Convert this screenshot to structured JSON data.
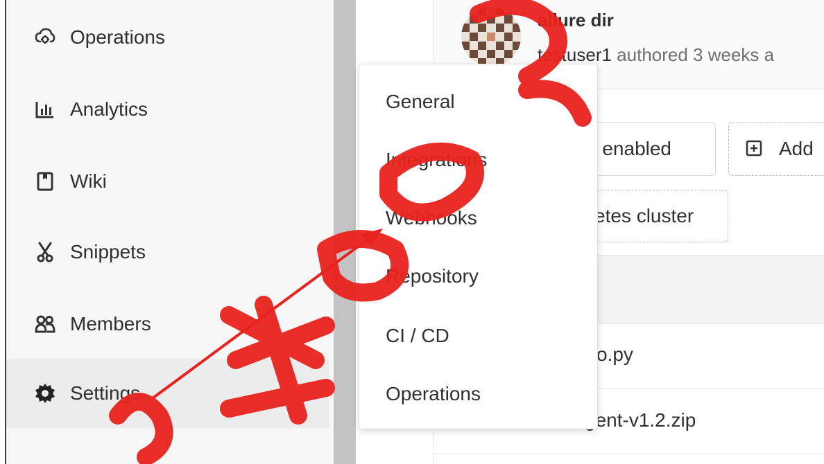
{
  "sidebar": {
    "items": [
      {
        "label": "Operations",
        "icon": "cloud-gear-icon"
      },
      {
        "label": "Analytics",
        "icon": "bar-chart-icon"
      },
      {
        "label": "Wiki",
        "icon": "book-icon"
      },
      {
        "label": "Snippets",
        "icon": "scissors-icon"
      },
      {
        "label": "Members",
        "icon": "users-icon"
      },
      {
        "label": "Settings",
        "icon": "gear-icon",
        "active": true
      }
    ]
  },
  "commit": {
    "title": "allure dir",
    "author": "testuser1",
    "meta": " authored 3 weeks a"
  },
  "buttons": {
    "auto_devops": "ps enabled",
    "add": "Add",
    "kubernetes": "etes cluster"
  },
  "files": [
    {
      "name": "o.py"
    },
    {
      "name": "gent-v1.2.zip"
    }
  ],
  "settings_menu": {
    "items": [
      {
        "label": "General"
      },
      {
        "label": "Integrations"
      },
      {
        "label": "Webhooks"
      },
      {
        "label": "Repository"
      },
      {
        "label": "CI / CD"
      },
      {
        "label": "Operations"
      }
    ]
  },
  "annotation": {
    "arrow_color": "#e8231f",
    "watermark_color": "#e8231f"
  }
}
